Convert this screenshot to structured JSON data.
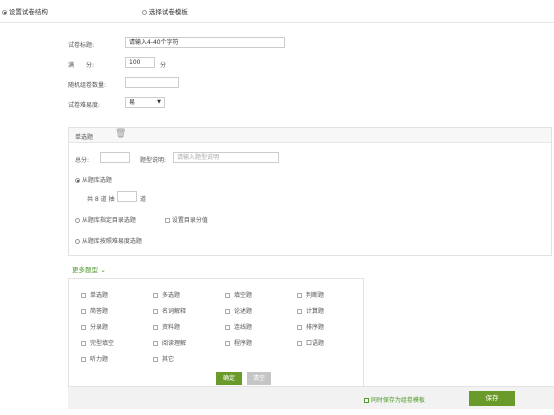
{
  "tabs": [
    {
      "label": "设置试卷结构",
      "active": true
    },
    {
      "label": "选择试卷模板",
      "active": false
    }
  ],
  "form": {
    "title_label": "试卷标题:",
    "title_value": "请输入4-40个字符",
    "score_label": "满　　分:",
    "score_value": "100",
    "score_unit": "分",
    "random_label": "随机组卷数量:",
    "random_value": "",
    "difficulty_label": "试卷难易度:",
    "difficulty_value": "易"
  },
  "section": {
    "title": "单选题",
    "total_label": "总分:",
    "total_value": "",
    "desc_label": "题型说明:",
    "desc_placeholder": "请输入题型说明",
    "opt1_label": "从题库选题",
    "pick_prefix": "共 8 道 抽",
    "pick_suffix": "道",
    "opt2_label": "从题库指定目录选题",
    "setdir_label": "设置目录分值",
    "opt3_label": "从题库按照难易度选题"
  },
  "more_types": {
    "toggle_label": "更多题型",
    "items": [
      "单选题",
      "多选题",
      "填空题",
      "判断题",
      "简答题",
      "名词解释",
      "论述题",
      "计算题",
      "分录题",
      "资料题",
      "连线题",
      "排序题",
      "完型填空",
      "阅读理解",
      "程序题",
      "口语题",
      "听力题",
      "其它"
    ],
    "confirm_label": "确定",
    "clear_label": "清空"
  },
  "footer": {
    "save_template_label": "同时保存为组卷模板",
    "save_label": "保存"
  },
  "colors": {
    "accent_green": "#6a9a2a",
    "link_green": "#4f9a2c"
  }
}
